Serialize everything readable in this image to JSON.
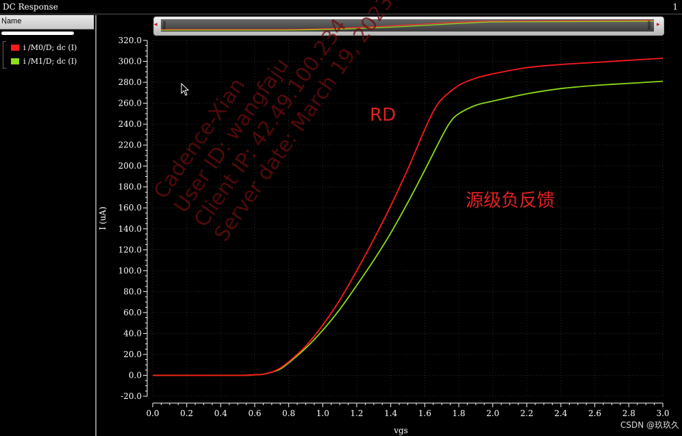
{
  "window": {
    "title": "DC Response",
    "number": "1"
  },
  "panel": {
    "header": "Name"
  },
  "legend": [
    {
      "label": "i /M0/D; dc (I)",
      "color": "#ff1a1a"
    },
    {
      "label": "i /M1/D; dc (I)",
      "color": "#8fdd1a"
    }
  ],
  "annotations": {
    "rd": "RD",
    "feedback": "源级负反馈"
  },
  "watermark": {
    "lines": [
      "Cadence-Xian",
      "User ID: wangfaju",
      "Client IP: 42.49.100.234",
      "Server date: March 19, 2023"
    ]
  },
  "credit": "CSDN @玖玖久",
  "chart_data": {
    "type": "line",
    "xlabel": "vgs",
    "ylabel": "I (uA)",
    "xlim": [
      0,
      3.0
    ],
    "ylim": [
      -20,
      320
    ],
    "xticks": [
      "0.0",
      "0.2",
      "0.4",
      "0.6",
      "0.8",
      "1.0",
      "1.2",
      "1.4",
      "1.6",
      "1.8",
      "2.0",
      "2.2",
      "2.4",
      "2.6",
      "2.8",
      "3.0"
    ],
    "yticks": [
      "-20.0",
      "0.0",
      "20.0",
      "40.0",
      "60.0",
      "80.0",
      "100.0",
      "120.0",
      "140.0",
      "160.0",
      "180.0",
      "200.0",
      "220.0",
      "240.0",
      "260.0",
      "280.0",
      "300.0",
      "320.0"
    ],
    "grid": true,
    "series": [
      {
        "name": "i /M0/D; dc (I)",
        "color": "#ff1a1a",
        "x": [
          0,
          0.5,
          0.6,
          0.65,
          0.7,
          0.75,
          0.8,
          0.9,
          1.0,
          1.1,
          1.2,
          1.3,
          1.4,
          1.5,
          1.6,
          1.65,
          1.7,
          1.8,
          1.9,
          2.0,
          2.2,
          2.4,
          2.6,
          2.8,
          3.0
        ],
        "y": [
          0,
          0,
          0.5,
          1,
          3,
          7,
          13,
          28,
          48,
          72,
          100,
          130,
          162,
          197,
          235,
          252,
          264,
          277,
          284,
          288,
          294,
          297,
          299,
          301,
          303
        ]
      },
      {
        "name": "i /M1/D; dc (I)",
        "color": "#8fdd1a",
        "x": [
          0,
          0.5,
          0.6,
          0.65,
          0.7,
          0.75,
          0.8,
          0.9,
          1.0,
          1.1,
          1.2,
          1.3,
          1.4,
          1.5,
          1.6,
          1.7,
          1.75,
          1.8,
          1.9,
          2.0,
          2.2,
          2.4,
          2.6,
          2.8,
          3.0
        ],
        "y": [
          0,
          0,
          0.5,
          1,
          3,
          6,
          12,
          26,
          43,
          63,
          86,
          110,
          136,
          165,
          196,
          228,
          242,
          250,
          258,
          262,
          269,
          274,
          277,
          279,
          281
        ]
      }
    ]
  }
}
